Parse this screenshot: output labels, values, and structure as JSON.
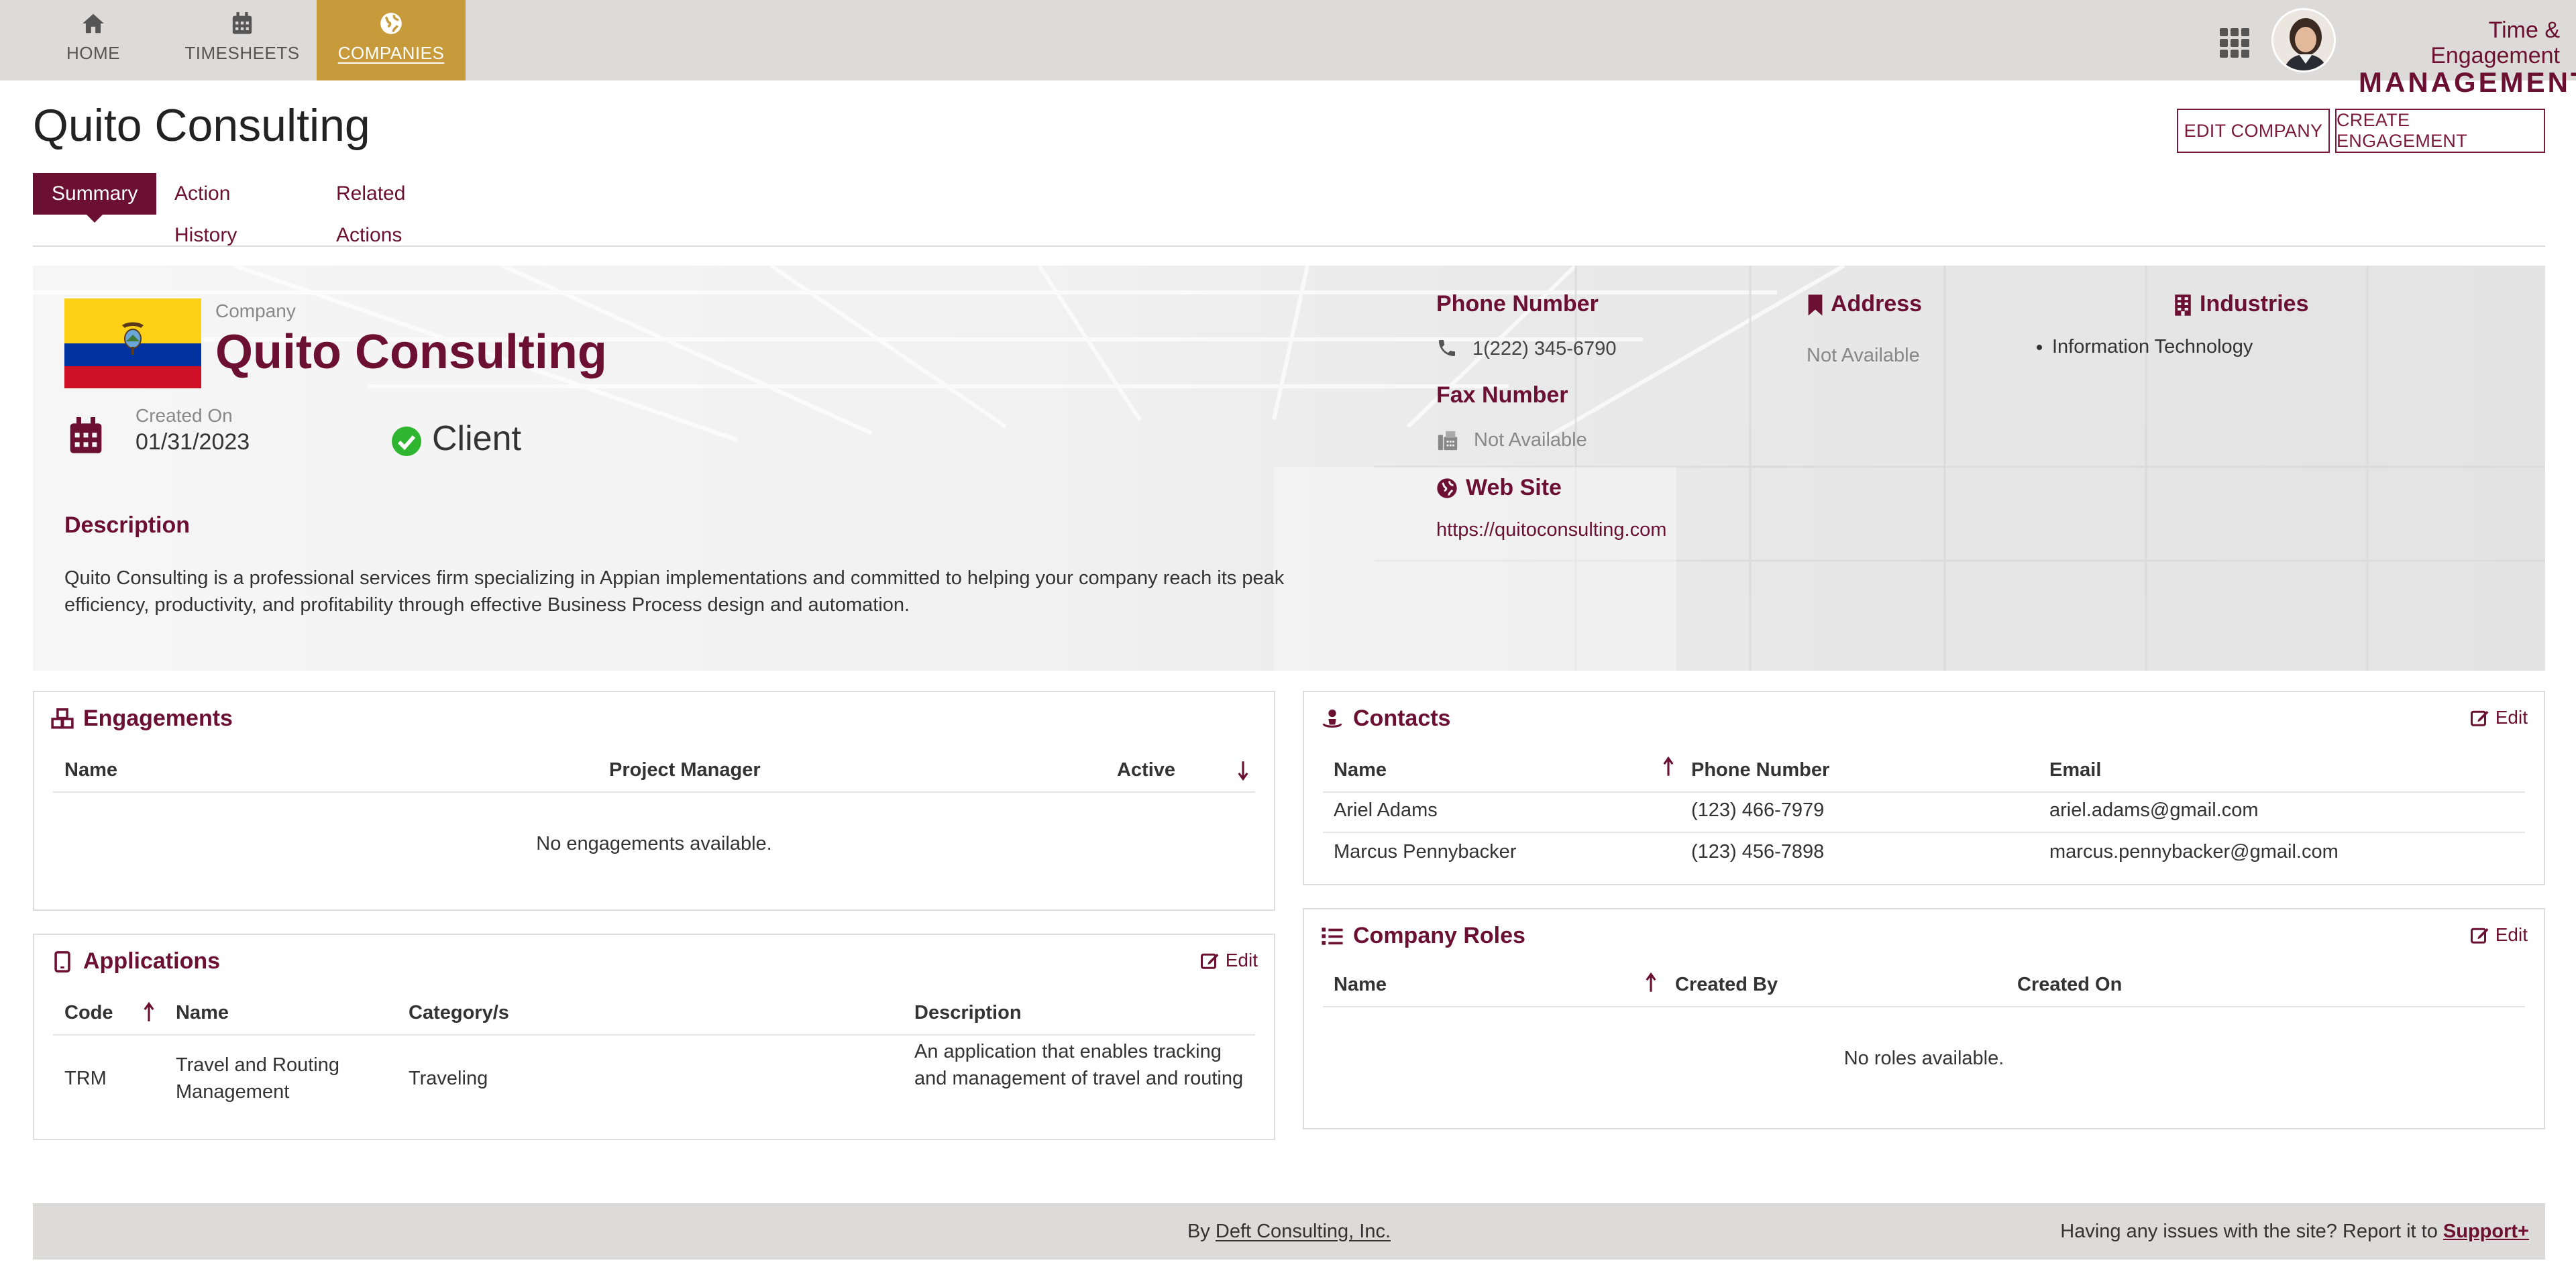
{
  "nav": {
    "items": [
      {
        "label": "HOME",
        "icon": "home-icon"
      },
      {
        "label": "TIMESHEETS",
        "icon": "calendar-icon"
      },
      {
        "label": "COMPANIES",
        "icon": "globe-icon",
        "active": true
      }
    ],
    "brand_line1": "Time & Engagement",
    "brand_line2": "MANAGEMENT"
  },
  "header": {
    "title": "Quito Consulting",
    "edit_button": "EDIT COMPANY",
    "create_button": "CREATE ENGAGEMENT",
    "tabs": [
      "Summary",
      "Action History",
      "Related Actions"
    ],
    "active_tab": "Summary"
  },
  "company": {
    "label": "Company",
    "name": "Quito Consulting",
    "created_label": "Created On",
    "created_value": "01/31/2023",
    "status": "Client",
    "description_label": "Description",
    "description": "Quito Consulting is a professional services firm specializing in Appian implementations and committed to helping your company reach its peak efficiency, productivity, and profitability through effective Business Process design and automation.",
    "phone_label": "Phone Number",
    "phone": "1(222) 345-6790",
    "fax_label": "Fax Number",
    "fax": "Not Available",
    "website_label": "Web Site",
    "website": "https://quitoconsulting.com",
    "address_label": "Address",
    "address": "Not Available",
    "industries_label": "Industries",
    "industries": [
      "Information Technology"
    ]
  },
  "engagements": {
    "title": "Engagements",
    "columns": [
      "Name",
      "Project Manager",
      "Active"
    ],
    "empty": "No engagements available."
  },
  "applications": {
    "title": "Applications",
    "edit": "Edit",
    "columns": [
      "Code",
      "Name",
      "Category/s",
      "Description"
    ],
    "rows": [
      {
        "code": "TRM",
        "name": "Travel and Routing Management",
        "category": "Traveling",
        "description": "An application that enables tracking and management of travel and routing"
      }
    ]
  },
  "contacts": {
    "title": "Contacts",
    "edit": "Edit",
    "columns": [
      "Name",
      "Phone Number",
      "Email"
    ],
    "rows": [
      {
        "name": "Ariel Adams",
        "phone": "(123) 466-7979",
        "email": "ariel.adams@gmail.com"
      },
      {
        "name": "Marcus Pennybacker",
        "phone": "(123) 456-7898",
        "email": "marcus.pennybacker@gmail.com"
      }
    ]
  },
  "roles": {
    "title": "Company Roles",
    "edit": "Edit",
    "columns": [
      "Name",
      "Created By",
      "Created On"
    ],
    "empty": "No roles available."
  },
  "footer": {
    "by_prefix": "By",
    "by_link": "Deft Consulting, Inc.",
    "issues_text": "Having any issues with the site? Report it to",
    "support_link": "Support+"
  },
  "colors": {
    "accent": "#6b1030",
    "nav_active": "#c79a3b",
    "nav_bg": "#dddada",
    "status_ok": "#2fb52f"
  }
}
